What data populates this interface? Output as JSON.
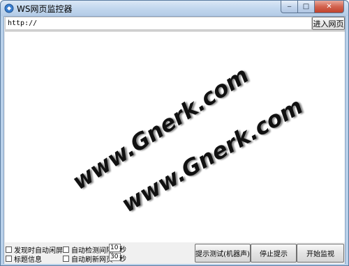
{
  "window": {
    "title": "WS网页监控器",
    "controls": {
      "minimize": "‒",
      "maximize": "□",
      "close": "✕"
    }
  },
  "address_bar": {
    "url_value": "http://",
    "enter_label": "进入网页"
  },
  "viewer": {
    "watermarks": [
      "www.Gnerk.com",
      "www.Gnerk.com"
    ]
  },
  "options": {
    "lock_on_find_label": "发现时自动闲屏",
    "title_info_label": "标题信息",
    "auto_check_label": "自动检测间隔",
    "auto_check_value": "10",
    "auto_check_unit": "秒",
    "auto_refresh_label": "自动刷新网页",
    "auto_refresh_value": "30",
    "auto_refresh_unit": "秒"
  },
  "buttons": {
    "test_label": "提示测试(机器声)",
    "stop_label": "停止提示",
    "start_label": "开始监视"
  }
}
